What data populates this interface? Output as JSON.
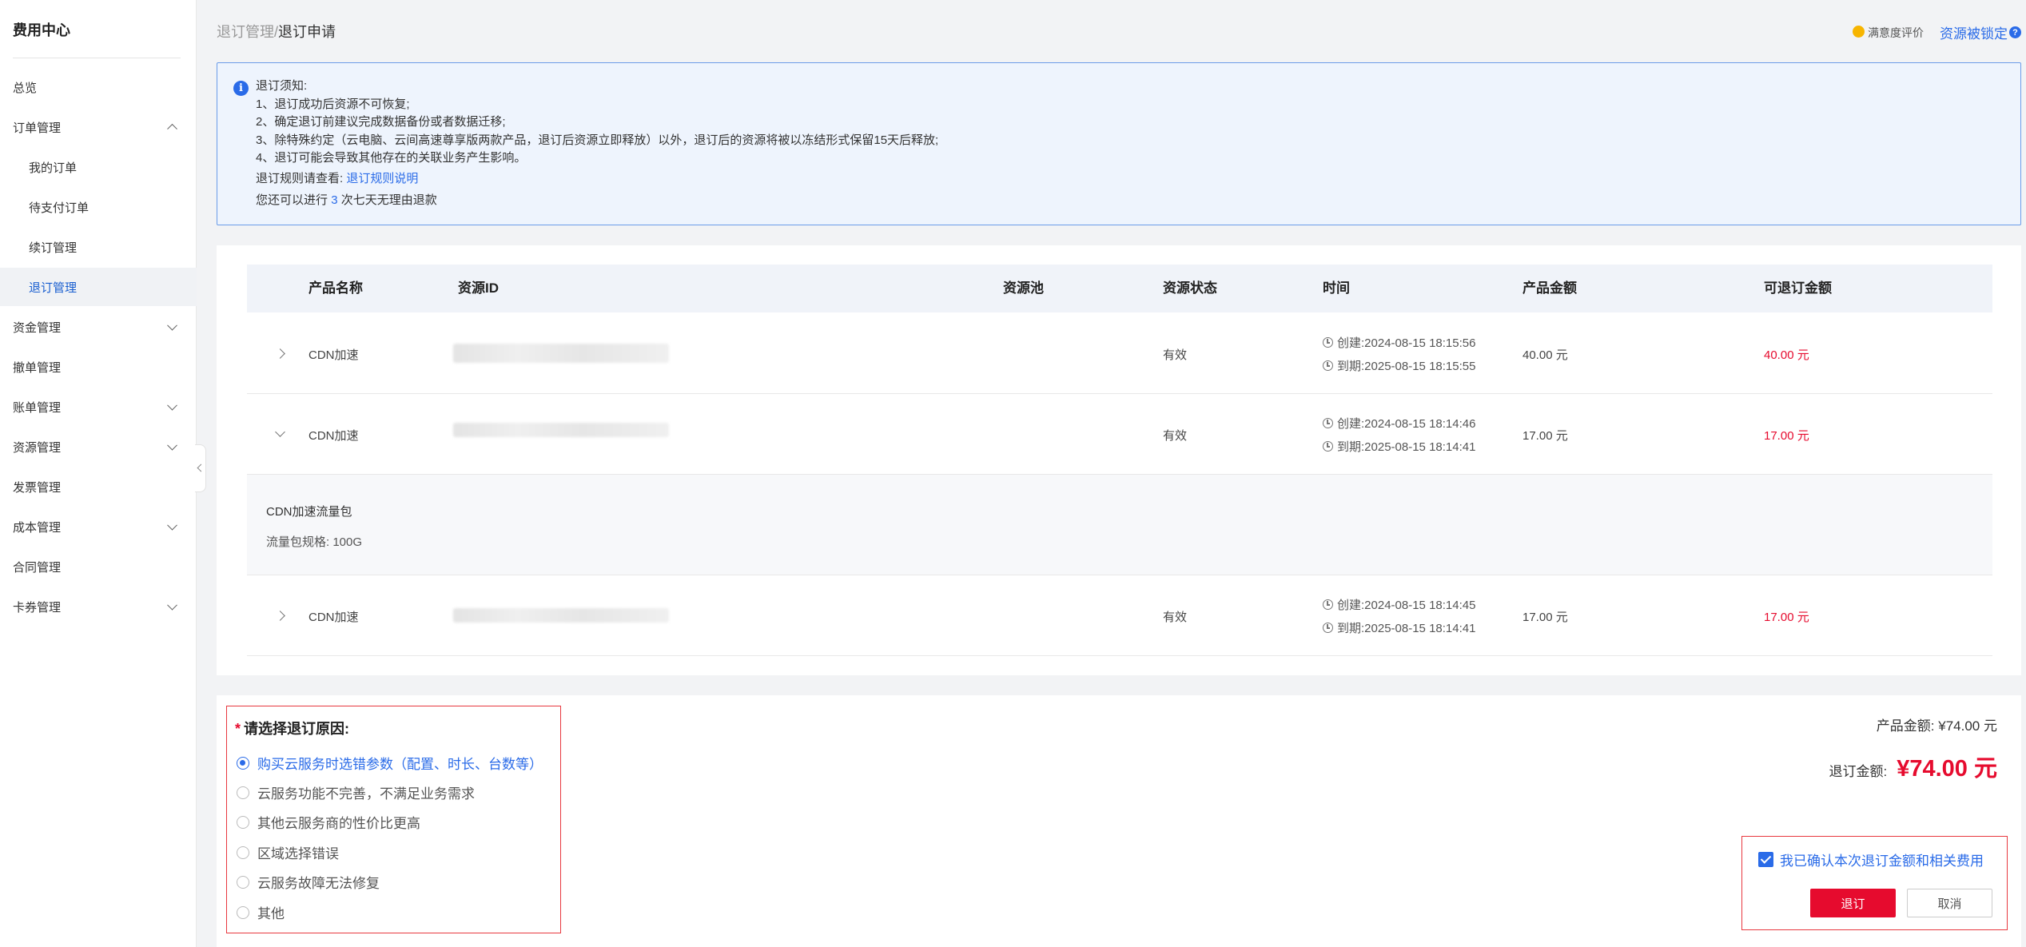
{
  "sidebar": {
    "title": "费用中心",
    "items": [
      {
        "label": "总览"
      },
      {
        "label": "订单管理"
      },
      {
        "label": "我的订单"
      },
      {
        "label": "待支付订单"
      },
      {
        "label": "续订管理"
      },
      {
        "label": "退订管理"
      },
      {
        "label": "资金管理"
      },
      {
        "label": "撤单管理"
      },
      {
        "label": "账单管理"
      },
      {
        "label": "资源管理"
      },
      {
        "label": "发票管理"
      },
      {
        "label": "成本管理"
      },
      {
        "label": "合同管理"
      },
      {
        "label": "卡券管理"
      }
    ]
  },
  "header": {
    "breadcrumb_parent": "退订管理",
    "breadcrumb_sep": "/",
    "breadcrumb_current": "退订申请",
    "rating_label": "满意度评价",
    "locked_label": "资源被锁定"
  },
  "notice": {
    "title": "退订须知:",
    "lines": [
      "1、退订成功后资源不可恢复;",
      "2、确定退订前建议完成数据备份或者数据迁移;",
      "3、除特殊约定（云电脑、云间高速尊享版两款产品，退订后资源立即释放）以外，退订后的资源将被以冻结形式保留15天后释放;",
      "4、退订可能会导致其他存在的关联业务产生影响。"
    ],
    "rule_prefix": "退订规则请查看:",
    "rule_link": "退订规则说明",
    "times_prefix": "您还可以进行",
    "times_count": "3",
    "times_suffix": "次七天无理由退款"
  },
  "table": {
    "columns": [
      "产品名称",
      "资源ID",
      "资源池",
      "资源状态",
      "时间",
      "产品金额",
      "可退订金额"
    ],
    "rows": [
      {
        "product": "CDN加速",
        "status": "有效",
        "created": "创建:2024-08-15 18:15:56",
        "expires": "到期:2025-08-15 18:15:55",
        "amount": "40.00 元",
        "refund": "40.00 元"
      },
      {
        "product": "CDN加速",
        "status": "有效",
        "created": "创建:2024-08-15 18:14:46",
        "expires": "到期:2025-08-15 18:14:41",
        "amount": "17.00 元",
        "refund": "17.00 元"
      },
      {
        "product": "CDN加速",
        "status": "有效",
        "created": "创建:2024-08-15 18:14:45",
        "expires": "到期:2025-08-15 18:14:41",
        "amount": "17.00 元",
        "refund": "17.00 元"
      }
    ],
    "detail": {
      "name": "CDN加速流量包",
      "spec": "流量包规格: 100G"
    }
  },
  "reason": {
    "required_mark": "*",
    "title": "请选择退订原因:",
    "options": [
      {
        "label": "购买云服务时选错参数（配置、时长、台数等）"
      },
      {
        "label": "云服务功能不完善，不满足业务需求"
      },
      {
        "label": "其他云服务商的性价比更高"
      },
      {
        "label": "区域选择错误"
      },
      {
        "label": "云服务故障无法修复"
      },
      {
        "label": "其他"
      }
    ]
  },
  "summary": {
    "product_amount_label": "产品金额:",
    "product_amount": "¥74.00 元",
    "refund_amount_label": "退订金额:",
    "refund_amount": "¥74.00 元"
  },
  "confirm": {
    "checkbox_label": "我已确认本次退订金额和相关费用",
    "submit_label": "退订",
    "cancel_label": "取消"
  },
  "colors": {
    "accent": "#2a6be8",
    "danger": "#e60b2e",
    "notice_bg": "#eef4fd"
  }
}
